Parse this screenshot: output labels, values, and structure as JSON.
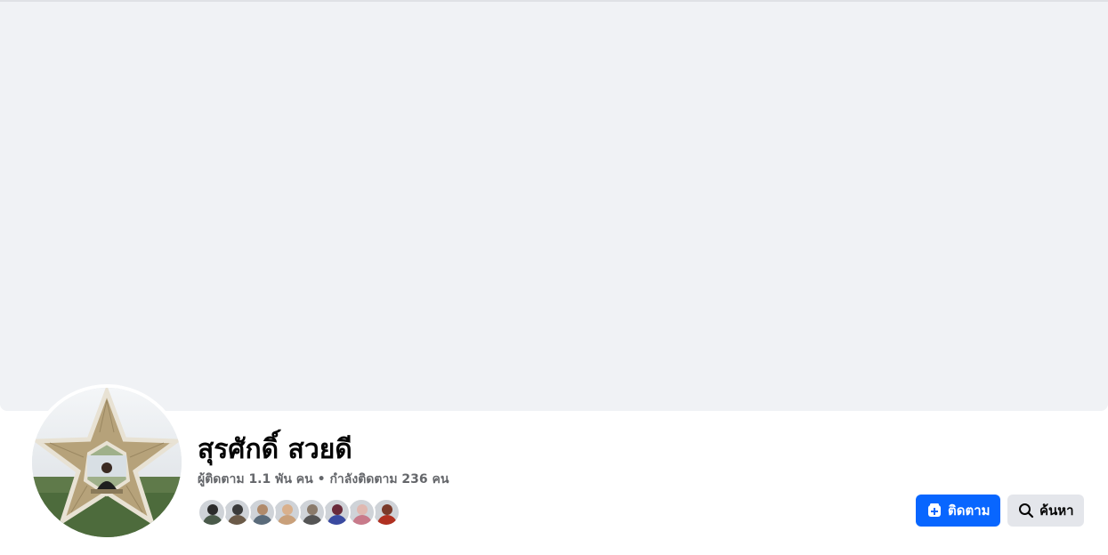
{
  "profile": {
    "name": "สุรศักดิ์ สวยดี",
    "followers_text": "ผู้ติดตาม 1.1 พัน คน",
    "separator": "•",
    "following_text": "กำลังติดตาม 236 คน"
  },
  "friends": [
    {
      "head": "#2b2b2b",
      "body": "#4a5a4a"
    },
    {
      "head": "#3a3a3a",
      "body": "#6b5a48"
    },
    {
      "head": "#b08a6a",
      "body": "#5a6b7a"
    },
    {
      "head": "#d9b08c",
      "body": "#c9a07a"
    },
    {
      "head": "#8a7a6a",
      "body": "#555555"
    },
    {
      "head": "#6a2a3a",
      "body": "#3a4aa0"
    },
    {
      "head": "#e0b8b0",
      "body": "#c87a8a"
    },
    {
      "head": "#7a3a2a",
      "body": "#b03020"
    }
  ],
  "actions": {
    "follow_label": "ติดตาม",
    "follow_icon": "add-friend-icon",
    "search_label": "ค้นหา",
    "search_icon": "search-icon"
  },
  "colors": {
    "cover": "#f0f2f5",
    "primary": "#0866ff",
    "secondary_button": "#e4e6eb",
    "muted_text": "#65676b"
  }
}
